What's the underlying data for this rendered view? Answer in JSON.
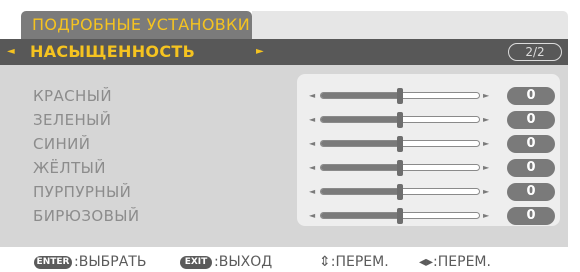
{
  "tab": {
    "title": "ПОДРОБНЫЕ УСТАНОВКИ"
  },
  "header": {
    "left_arrow": "◄",
    "title": "НАСЫЩЕННОСТЬ",
    "right_arrow": "►",
    "page": "2/2"
  },
  "rows": [
    {
      "label": "КРАСНЫЙ",
      "value": "0",
      "level": 0.5
    },
    {
      "label": "ЗЕЛЕНЫЙ",
      "value": "0",
      "level": 0.5
    },
    {
      "label": "СИНИЙ",
      "value": "0",
      "level": 0.5
    },
    {
      "label": "ЖЁЛТЫЙ",
      "value": "0",
      "level": 0.5
    },
    {
      "label": "ПУРПУРНЫЙ",
      "value": "0",
      "level": 0.5
    },
    {
      "label": "БИРЮЗОВЫЙ",
      "value": "0",
      "level": 0.5
    }
  ],
  "slider_arrows": {
    "left": "◄",
    "right": "►"
  },
  "footer": {
    "enter_key": "ENTER",
    "enter_text": ":ВЫБРАТЬ",
    "exit_key": "EXIT",
    "exit_text": ":ВЫХОД",
    "updown_text": "⇕:ПЕРЕМ.",
    "leftright_text": "◂▸:ПЕРЕМ."
  },
  "colors": {
    "accent": "#f5c320",
    "header_bg": "#585858",
    "panel_bg": "#d6d6d6",
    "value_badge": "#7a7a7a"
  }
}
